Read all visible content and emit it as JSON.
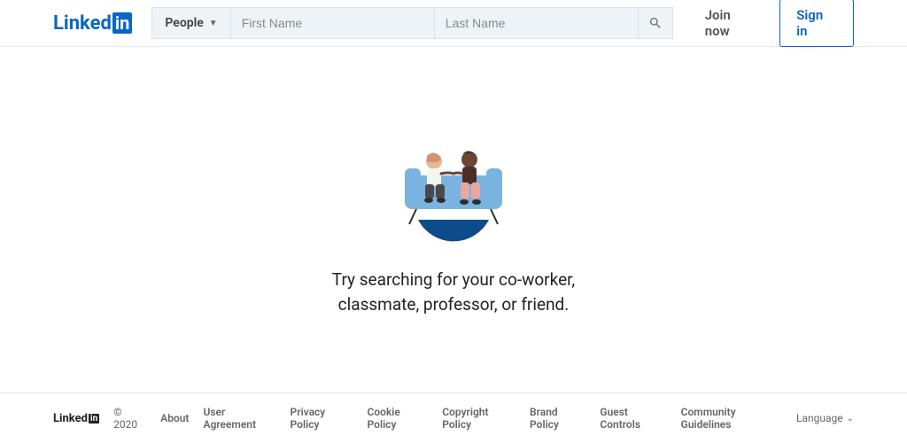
{
  "header": {
    "logo_text": "Linked",
    "logo_box": "in",
    "search_type": "People",
    "first_name_placeholder": "First Name",
    "last_name_placeholder": "Last Name",
    "join_label": "Join now",
    "signin_label": "Sign in"
  },
  "main": {
    "prompt_line1": "Try searching for your co-worker,",
    "prompt_line2": "classmate, professor, or friend."
  },
  "footer": {
    "logo_text": "Linked",
    "logo_box": "in",
    "copyright": "© 2020",
    "links": [
      "About",
      "User Agreement",
      "Privacy Policy",
      "Cookie Policy",
      "Copyright Policy",
      "Brand Policy",
      "Guest Controls",
      "Community Guidelines"
    ],
    "language_label": "Language"
  }
}
